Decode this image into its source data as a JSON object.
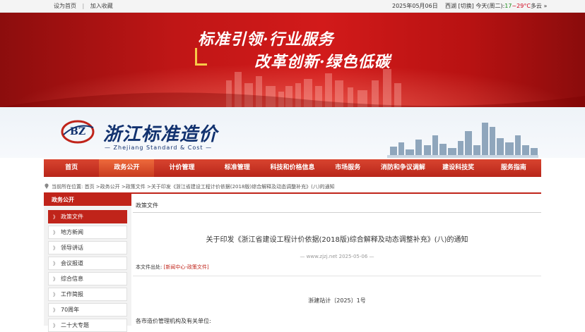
{
  "topbar": {
    "set_home": "设为首页",
    "separator": "|",
    "add_fav": "加入收藏",
    "date": "2025年05月06日",
    "city": "西湖",
    "switch": "[切换]",
    "weather_prefix": "今天(周二):",
    "temp_low": "17",
    "temp_sep": "~",
    "temp_high": "29°C",
    "condition": "多云",
    "more": "»"
  },
  "banner": {
    "slogan_line1": "标准引领·行业服务",
    "slogan_line2": "改革创新·绿色低碳"
  },
  "header": {
    "logo_text": "BZ",
    "brand": "浙江标准造价",
    "brand_sub": "— Zhejiang Standard & Cost —"
  },
  "nav": [
    {
      "label": "首页",
      "name": "nav-home"
    },
    {
      "label": "政务公开",
      "name": "nav-gov-affairs"
    },
    {
      "label": "计价管理",
      "name": "nav-pricing"
    },
    {
      "label": "标准管理",
      "name": "nav-standards"
    },
    {
      "label": "科技和价格信息",
      "name": "nav-tech-price"
    },
    {
      "label": "市场服务",
      "name": "nav-market"
    },
    {
      "label": "消防和争议调解",
      "name": "nav-fire-dispute"
    },
    {
      "label": "建设科技奖",
      "name": "nav-award"
    },
    {
      "label": "服务指南",
      "name": "nav-guide"
    }
  ],
  "breadcrumb": "当前所在位置: 首页 >政务公开 >政策文件 >关于印发《浙江省建设工程计价依据(2018版)综合解释及动态调整补充》(八)的通知",
  "sidebar": {
    "title": "政务公开",
    "items": [
      {
        "label": "政策文件",
        "active": true
      },
      {
        "label": "地方新闻",
        "active": false
      },
      {
        "label": "领导讲话",
        "active": false
      },
      {
        "label": "会议报道",
        "active": false
      },
      {
        "label": "综合信息",
        "active": false
      },
      {
        "label": "工作简报",
        "active": false
      },
      {
        "label": "70周年",
        "active": false
      },
      {
        "label": "二十大专题",
        "active": false
      }
    ]
  },
  "main": {
    "tab": "政策文件",
    "title": "关于印发《浙江省建设工程计价依据(2018版)综合解释及动态调整补充》(八)的通知",
    "meta": "— www.zjzj.net 2025-05-06 —",
    "source_label": "本文件出处:",
    "source_link": "[新闻中心-政策文件]",
    "doc_number": "浙建站计〔2025〕1号",
    "addressee": "各市造价管理机构及有关单位:"
  },
  "colors": {
    "brand_red": "#c0241a",
    "nav_active": "#ee6a3c",
    "brand_blue": "#12326f"
  }
}
